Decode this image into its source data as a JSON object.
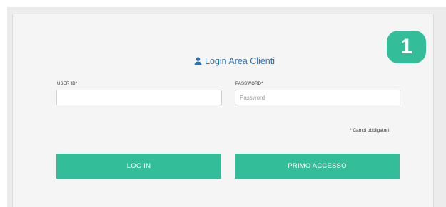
{
  "badge": {
    "step": "1"
  },
  "header": {
    "title": "Login Area Clienti",
    "icon": "user-icon"
  },
  "form": {
    "user_id_label": "USER ID*",
    "user_id_value": "",
    "password_label": "PASSWORD*",
    "password_placeholder": "Password",
    "required_note": "* Campi obbligatori"
  },
  "buttons": {
    "login_label": "LOG IN",
    "first_access_label": "PRIMO ACCESSO"
  },
  "colors": {
    "accent": "#33bd99",
    "title": "#2a72b5",
    "panel_bg": "#f5f5f5"
  }
}
